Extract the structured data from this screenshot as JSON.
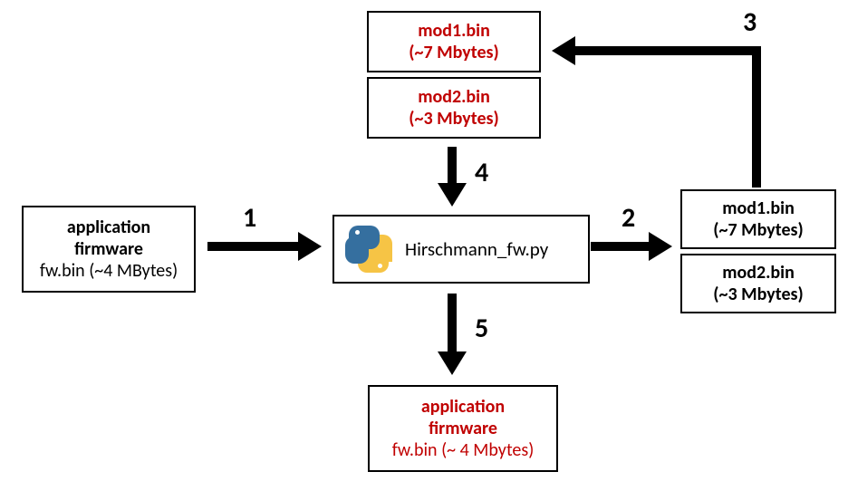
{
  "top_mod1": {
    "name": "mod1.bin",
    "size": "(~7 Mbytes)"
  },
  "top_mod2": {
    "name": "mod2.bin",
    "size": "(~3 Mbytes)"
  },
  "right_mod1": {
    "name": "mod1.bin",
    "size": "(~7 Mbytes)"
  },
  "right_mod2": {
    "name": "mod2.bin",
    "size": "(~3 Mbytes)"
  },
  "left_box": {
    "title": "application",
    "subtitle": "firmware",
    "file": "fw.bin (~4 MBytes)"
  },
  "bottom_box": {
    "title": "application",
    "subtitle": "firmware",
    "file": "fw.bin (~ 4 Mbytes)"
  },
  "center_box": {
    "script": "Hirschmann_fw.py"
  },
  "steps": {
    "s1": "1",
    "s2": "2",
    "s3": "3",
    "s4": "4",
    "s5": "5"
  }
}
